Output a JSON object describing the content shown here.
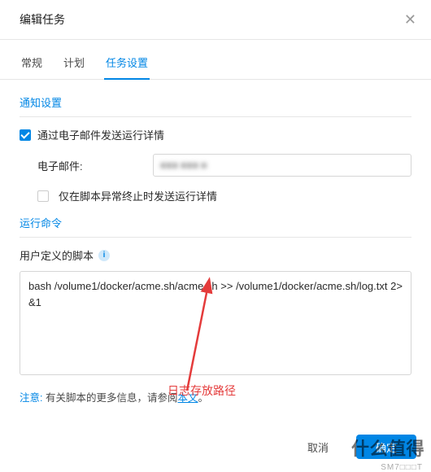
{
  "dialog": {
    "title": "编辑任务"
  },
  "tabs": {
    "items": [
      {
        "label": "常规"
      },
      {
        "label": "计划"
      },
      {
        "label": "任务设置"
      }
    ]
  },
  "notify": {
    "section_title": "通知设置",
    "send_email_label": "通过电子邮件发送运行详情",
    "email_label": "电子邮件:",
    "email_value": "■■■ ■■■ ■",
    "abnormal_only_label": "仅在脚本异常终止时发送运行详情"
  },
  "run": {
    "section_title": "运行命令",
    "script_label": "用户定义的脚本",
    "script_value": "bash /volume1/docker/acme.sh/acme.sh >> /volume1/docker/acme.sh/log.txt 2>&1",
    "note_label": "注意:",
    "note_text": "有关脚本的更多信息，请参阅",
    "note_link": "本文",
    "note_end": "。"
  },
  "annotation": {
    "log_path_text": "日志存放路径"
  },
  "footer": {
    "cancel": "取消",
    "ok": "确定"
  },
  "watermark": {
    "main": "什么值得",
    "sub": "SM7□□□T"
  }
}
